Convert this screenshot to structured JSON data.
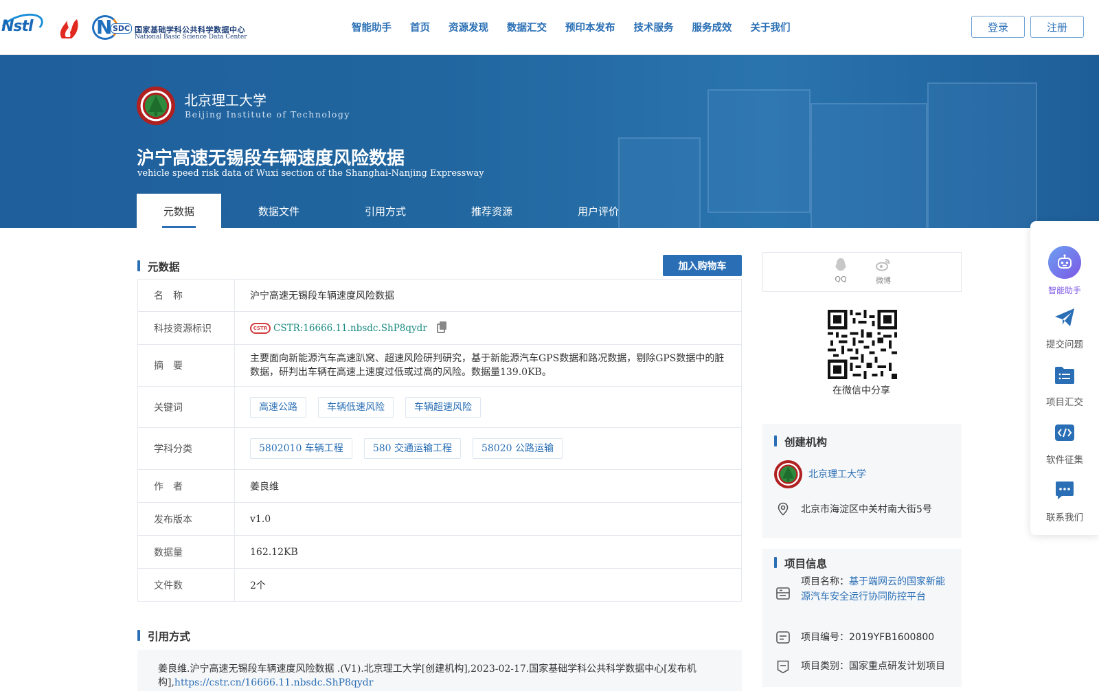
{
  "nav": {
    "menu": [
      "智能助手",
      "首页",
      "资源发现",
      "数据汇交",
      "预印本发布",
      "技术服务",
      "服务成效",
      "关于我们"
    ],
    "login": "登录",
    "register": "注册",
    "logos": {
      "nstl": "Nstl",
      "nsdc_mark": "N",
      "nsdc_badge": "SDC",
      "nsdc_cn": "国家基础学科公共科学数据中心",
      "nsdc_en": "National Basic Science Data Center"
    }
  },
  "banner": {
    "org_name": "北京理工大学",
    "org_en": "Beijing Institute of Technology",
    "title": "沪宁高速无锡段车辆速度风险数据",
    "title_en": "vehicle speed risk data of Wuxi section of the Shanghai-Nanjing Expressway",
    "tabs": [
      "元数据",
      "数据文件",
      "引用方式",
      "推荐资源",
      "用户评价"
    ],
    "active_tab": "元数据"
  },
  "metadata": {
    "heading": "元数据",
    "cart_button": "加入购物车",
    "rows": {
      "name_key": "名　称",
      "name_val": "沪宁高速无锡段车辆速度风险数据",
      "cstr_key": "科技资源标识",
      "cstr_logo": "CSTR",
      "cstr_val": "CSTR:16666.11.nbsdc.ShP8qydr",
      "abstract_key": "摘　要",
      "abstract_val": "主要面向新能源汽车高速趴窝、超速风险研判研究，基于新能源汽车GPS数据和路况数据，剔除GPS数据中的脏数据，研判出车辆在高速上速度过低或过高的风险。数据量139.0KB。",
      "keywords_key": "关键词",
      "keywords": [
        "高速公路",
        "车辆低速风险",
        "车辆超速风险"
      ],
      "subject_key": "学科分类",
      "subjects": [
        "5802010 车辆工程",
        "580 交通运输工程",
        "58020 公路运输"
      ],
      "author_key": "作　者",
      "author_val": "姜良维",
      "version_key": "发布版本",
      "version_val": "v1.0",
      "size_key": "数据量",
      "size_val": "162.12KB",
      "files_key": "文件数",
      "files_val": "2个"
    }
  },
  "citation": {
    "heading": "引用方式",
    "text": "姜良维.沪宁高速无锡段车辆速度风险数据 .(V1).北京理工大学[创建机构],2023-02-17.国家基础学科公共科学数据中心[发布机构],",
    "link": "https://cstr.cn/16666.11.nbsdc.ShP8qydr"
  },
  "share": {
    "qq": "QQ",
    "weibo": "微博",
    "qr_caption": "在微信中分享"
  },
  "creator": {
    "heading": "创建机构",
    "org": "北京理工大学",
    "address": "北京市海淀区中关村南大街5号"
  },
  "project": {
    "heading": "项目信息",
    "name_label": "项目名称：",
    "name_val": "基于端网云的国家新能源汽车安全运行协同防控平台",
    "code_label": "项目编号：",
    "code_val": "2019YFB1600800",
    "type_label": "项目类别：",
    "type_val": "国家重点研发计划项目"
  },
  "floatbar": {
    "items": [
      "智能助手",
      "提交问题",
      "项目汇交",
      "软件征集",
      "联系我们"
    ]
  },
  "colors": {
    "accent": "#2a6fb5",
    "banner": "#21669f",
    "assistant_purple": "#7e57e6"
  }
}
